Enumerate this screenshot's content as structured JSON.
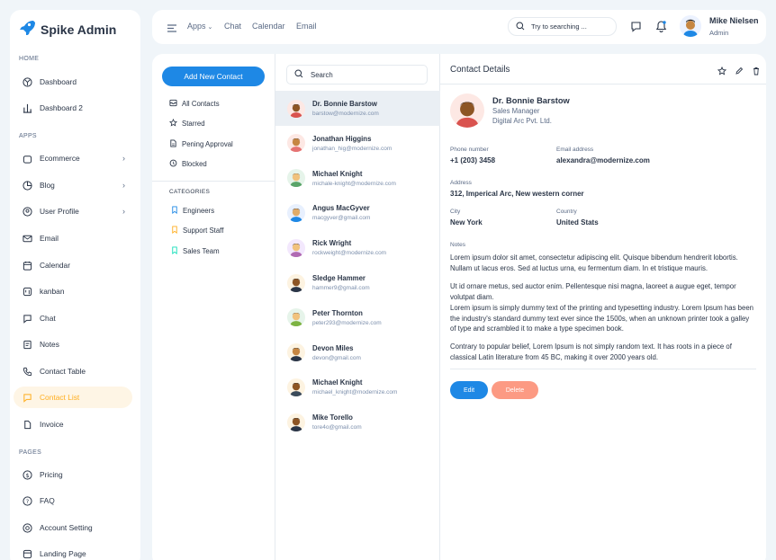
{
  "brand": {
    "name": "Spike Admin"
  },
  "topbar": {
    "apps": "Apps",
    "chat": "Chat",
    "calendar": "Calendar",
    "email": "Email",
    "search_placeholder": "Try to searching ...",
    "user_name": "Mike Nielsen",
    "user_role": "Admin"
  },
  "sidebar": {
    "home_label": "HOME",
    "apps_label": "APPS",
    "pages_label": "PAGES",
    "home_items": [
      {
        "label": "Dashboard",
        "icon": "aperture-icon"
      },
      {
        "label": "Dashboard 2",
        "icon": "chart-bars-icon"
      }
    ],
    "app_items": [
      {
        "label": "Ecommerce",
        "icon": "basket-icon"
      },
      {
        "label": "Blog",
        "icon": "pie-chart-icon"
      },
      {
        "label": "User Profile",
        "icon": "user-circle-icon"
      },
      {
        "label": "Email",
        "icon": "mail-icon"
      },
      {
        "label": "Calendar",
        "icon": "calendar-icon"
      },
      {
        "label": "kanban",
        "icon": "kanban-icon"
      },
      {
        "label": "Chat",
        "icon": "chat-icon"
      },
      {
        "label": "Notes",
        "icon": "notes-icon"
      },
      {
        "label": "Contact Table",
        "icon": "phone-icon"
      },
      {
        "label": "Contact List",
        "icon": "list-icon"
      },
      {
        "label": "Invoice",
        "icon": "invoice-icon"
      }
    ],
    "page_items": [
      {
        "label": "Pricing",
        "icon": "currency-icon"
      },
      {
        "label": "FAQ",
        "icon": "help-icon"
      },
      {
        "label": "Account Setting",
        "icon": "settings-icon"
      },
      {
        "label": "Landing Page",
        "icon": "app-window-icon"
      }
    ]
  },
  "filters": {
    "add_button": "Add New Contact",
    "items": [
      {
        "label": "All Contacts",
        "icon": "mail-icon"
      },
      {
        "label": "Starred",
        "icon": "star-icon"
      },
      {
        "label": "Pening Approval",
        "icon": "file-icon"
      },
      {
        "label": "Blocked",
        "icon": "blocked-icon"
      }
    ],
    "categories_label": "CATEGORIES",
    "categories": [
      {
        "label": "Engineers",
        "color": "#1e88e5"
      },
      {
        "label": "Support Staff",
        "color": "#ffae1f"
      },
      {
        "label": "Sales Team",
        "color": "#13deb9"
      }
    ]
  },
  "contacts": {
    "search_placeholder": "Search",
    "items": [
      {
        "name": "Dr. Bonnie Barstow",
        "email": "barstow@modernize.com"
      },
      {
        "name": "Jonathan Higgins",
        "email": "jonathan_hig@modernize.com"
      },
      {
        "name": "Michael Knight",
        "email": "michale-knight@modernize.com"
      },
      {
        "name": "Angus MacGyver",
        "email": "macgyver@gmail.com"
      },
      {
        "name": "Rick Wright",
        "email": "rockweight@modernize.com"
      },
      {
        "name": "Sledge Hammer",
        "email": "hammer9@gmail.com"
      },
      {
        "name": "Peter Thornton",
        "email": "peter293@modernize.com"
      },
      {
        "name": "Devon Miles",
        "email": "devon@gmail.com"
      },
      {
        "name": "Michael Knight",
        "email": "michael_knight@modernize.com"
      },
      {
        "name": "Mike Torello",
        "email": "tore4o@gmail.com"
      }
    ]
  },
  "details": {
    "title": "Contact Details",
    "name": "Dr. Bonnie Barstow",
    "role": "Sales Manager",
    "company": "Digital Arc Pvt. Ltd.",
    "phone_label": "Phone number",
    "phone": "+1 (203) 3458",
    "email_label": "Email address",
    "email": "alexandra@modernize.com",
    "address_label": "Address",
    "address": "312, Imperical Arc, New western corner",
    "city_label": "City",
    "city": "New York",
    "country_label": "Country",
    "country": "United Stats",
    "notes_label": "Notes",
    "note1": "Lorem ipsum dolor sit amet, consectetur adipiscing elit. Quisque bibendum hendrerit lobortis. Nullam ut lacus eros. Sed at luctus urna, eu fermentum diam. In et tristique mauris.",
    "note2": "Ut id ornare metus, sed auctor enim. Pellentesque nisi magna, laoreet a augue eget, tempor volutpat diam.",
    "note3": "Lorem ipsum is simply dummy text of the printing and typesetting industry. Lorem Ipsum has been the industry's standard dummy text ever since the 1500s, when an unknown printer took a galley of type and scrambled it to make a type specimen book.",
    "note4": "Contrary to popular belief, Lorem Ipsum is not simply random text. It has roots in a piece of classical Latin literature from 45 BC, making it over 2000 years old.",
    "edit": "Edit",
    "delete": "Delete"
  },
  "colors": {
    "primary": "#1e88e5",
    "active_bg": "#fef5e5",
    "active_fg": "#ffae1f",
    "danger_soft": "#fc9a83"
  }
}
